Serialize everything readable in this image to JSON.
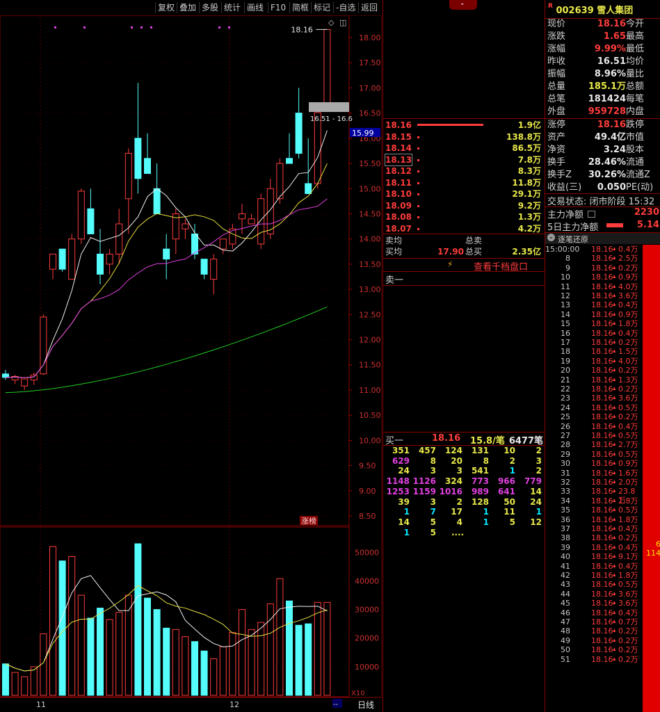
{
  "toolbar": {
    "items": [
      "复权",
      "叠加",
      "多股",
      "统计",
      "画线",
      "F10",
      "简框",
      "标记",
      "-自选",
      "返回"
    ]
  },
  "chart": {
    "price_ticks": [
      "18.00",
      "17.50",
      "17.00",
      "16.50",
      "16.00",
      "15.50",
      "15.00",
      "14.50",
      "14.00",
      "13.50",
      "13.00",
      "12.50",
      "12.00",
      "11.50",
      "11.00",
      "10.50",
      "10.00",
      "9.50",
      "9.00",
      "8.50"
    ],
    "volume_ticks": [
      "50000",
      "40000",
      "30000",
      "20000",
      "10000"
    ],
    "high_label": "18.16",
    "range_label": "16.51 - 16.6",
    "current_price_badge": "15.99",
    "zhangbang_label": "涨榜",
    "x10_label": "X10",
    "period_label": "日线",
    "month_labels": [
      "11",
      "12"
    ],
    "bottom_dash": "--"
  },
  "chart_data": {
    "type": "candlestick",
    "candles": [
      {
        "o": 11.32,
        "h": 11.4,
        "l": 11.2,
        "c": 11.25
      },
      {
        "o": 11.2,
        "h": 11.3,
        "l": 11.12,
        "c": 11.27
      },
      {
        "o": 11.08,
        "h": 11.22,
        "l": 11.0,
        "c": 11.22
      },
      {
        "o": 11.2,
        "h": 11.35,
        "l": 11.1,
        "c": 11.3
      },
      {
        "o": 11.32,
        "h": 12.5,
        "l": 11.3,
        "c": 12.45
      },
      {
        "o": 13.4,
        "h": 13.7,
        "l": 13.2,
        "c": 13.7
      },
      {
        "o": 13.8,
        "h": 13.8,
        "l": 13.35,
        "c": 13.4
      },
      {
        "o": 13.2,
        "h": 14.1,
        "l": 13.2,
        "c": 14.0
      },
      {
        "o": 14.0,
        "h": 15.0,
        "l": 13.9,
        "c": 14.95
      },
      {
        "o": 14.6,
        "h": 15.0,
        "l": 14.1,
        "c": 14.1
      },
      {
        "o": 13.7,
        "h": 14.2,
        "l": 13.1,
        "c": 13.3
      },
      {
        "o": 13.5,
        "h": 13.8,
        "l": 13.3,
        "c": 13.7
      },
      {
        "o": 13.7,
        "h": 14.6,
        "l": 13.5,
        "c": 14.3
      },
      {
        "o": 14.8,
        "h": 15.8,
        "l": 14.1,
        "c": 15.7
      },
      {
        "o": 16.0,
        "h": 17.1,
        "l": 14.9,
        "c": 15.2
      },
      {
        "o": 15.6,
        "h": 16.1,
        "l": 15.3,
        "c": 15.3
      },
      {
        "o": 15.0,
        "h": 15.5,
        "l": 14.5,
        "c": 14.5
      },
      {
        "o": 13.8,
        "h": 14.1,
        "l": 13.2,
        "c": 13.6
      },
      {
        "o": 14.0,
        "h": 14.6,
        "l": 13.7,
        "c": 14.5
      },
      {
        "o": 14.2,
        "h": 14.4,
        "l": 14.0,
        "c": 14.3
      },
      {
        "o": 14.1,
        "h": 14.3,
        "l": 13.6,
        "c": 13.7
      },
      {
        "o": 13.6,
        "h": 13.6,
        "l": 13.2,
        "c": 13.3
      },
      {
        "o": 13.2,
        "h": 13.7,
        "l": 12.9,
        "c": 13.6
      },
      {
        "o": 13.8,
        "h": 14.0,
        "l": 13.7,
        "c": 14.0
      },
      {
        "o": 13.9,
        "h": 14.3,
        "l": 13.8,
        "c": 14.2
      },
      {
        "o": 14.4,
        "h": 14.7,
        "l": 14.1,
        "c": 14.5
      },
      {
        "o": 14.3,
        "h": 14.5,
        "l": 14.3,
        "c": 14.4
      },
      {
        "o": 13.9,
        "h": 14.9,
        "l": 13.8,
        "c": 14.8
      },
      {
        "o": 14.1,
        "h": 15.2,
        "l": 14.0,
        "c": 15.0
      },
      {
        "o": 14.8,
        "h": 15.6,
        "l": 14.7,
        "c": 15.5
      },
      {
        "o": 15.6,
        "h": 16.1,
        "l": 15.5,
        "c": 15.5
      },
      {
        "o": 16.5,
        "h": 17.0,
        "l": 15.6,
        "c": 15.7
      },
      {
        "o": 15.1,
        "h": 16.0,
        "l": 14.9,
        "c": 14.9
      },
      {
        "o": 15.1,
        "h": 16.51,
        "l": 15.0,
        "c": 16.51
      },
      {
        "o": 16.6,
        "h": 18.16,
        "l": 16.6,
        "c": 18.16
      }
    ],
    "volumes": [
      11000,
      8000,
      6500,
      10000,
      21500,
      52000,
      47000,
      48500,
      35000,
      27000,
      30500,
      26500,
      29000,
      35000,
      53000,
      34000,
      30000,
      23500,
      23000,
      20500,
      18800,
      15500,
      12800,
      17000,
      22000,
      30000,
      23000,
      25500,
      32000,
      40800,
      33000,
      24500,
      25000,
      32500,
      32500
    ],
    "ma5_last": 15.9,
    "ma10_last": 15.4,
    "ma20_last": 14.9,
    "ma60_last": 12.65,
    "ylim": [
      8.3,
      18.3
    ],
    "vol_ylim": [
      0,
      53000
    ]
  },
  "quote": {
    "code_prefix": "R",
    "code": "002639",
    "name": "雪人集团",
    "rows": [
      {
        "l": "现价",
        "v": "18.16",
        "c": "red",
        "r": "今开"
      },
      {
        "l": "涨跌",
        "v": "1.65",
        "c": "red",
        "r": "最高"
      },
      {
        "l": "涨幅",
        "v": "9.99%",
        "c": "red",
        "r": "最低"
      },
      {
        "l": "昨收",
        "v": "16.51",
        "c": "white",
        "r": "均价"
      },
      {
        "l": "振幅",
        "v": "8.96%",
        "c": "white",
        "r": "量比"
      },
      {
        "l": "总量",
        "v": "185.1万",
        "c": "yellow",
        "r": "总额"
      },
      {
        "l": "总笔",
        "v": "181424",
        "c": "white",
        "r": "每笔"
      },
      {
        "l": "外盘",
        "v": "959728",
        "c": "red",
        "r": "内盘"
      }
    ],
    "rows2": [
      {
        "l": "涨停",
        "v": "18.16",
        "c": "red",
        "r": "跌停"
      },
      {
        "l": "资产",
        "v": "49.4亿",
        "c": "white",
        "r": "市值"
      },
      {
        "l": "净资",
        "v": "3.24",
        "c": "white",
        "r": "股本"
      },
      {
        "l": "换手",
        "v": "28.46%",
        "c": "white",
        "r": "流通"
      },
      {
        "l": "换手Z",
        "v": "30.26%",
        "c": "white",
        "r": "流通Z"
      },
      {
        "l": "收益(三)",
        "v": "0.050",
        "c": "white",
        "r": "PE(动)"
      }
    ],
    "trade_status": "交易状态: 闭市阶段 15:32",
    "main_net_label": "主力净额",
    "main_net_value": "2230",
    "five_day_label": "5日主力净额",
    "five_day_value": "5.14",
    "tick_header": "逐笔还原",
    "side_numbers": [
      "6",
      "114"
    ]
  },
  "book": {
    "asks": [
      {
        "p": "18.16",
        "q": "1.9亿",
        "w": 95
      },
      {
        "p": "18.15",
        "q": "138.8万",
        "w": 0
      },
      {
        "p": "18.14",
        "q": "86.5万",
        "w": 0
      },
      {
        "p": "18.13",
        "q": "7.8万",
        "w": 0
      },
      {
        "p": "18.12",
        "q": "8.3万",
        "w": 0
      },
      {
        "p": "18.11",
        "q": "11.8万",
        "w": 0
      },
      {
        "p": "18.10",
        "q": "29.1万",
        "w": 0
      },
      {
        "p": "18.09",
        "q": "9.2万",
        "w": 0
      },
      {
        "p": "18.08",
        "q": "1.3万",
        "w": 0
      },
      {
        "p": "18.07",
        "q": "4.2万",
        "w": 0
      }
    ],
    "sell_avg_label": "卖均",
    "total_sell_label": "总卖",
    "buy_avg_label": "买均",
    "buy_avg_value": "17.90",
    "total_buy_label": "总买",
    "total_buy_value": "2.35亿",
    "depth_link": "查看千档盘口",
    "sell1_label": "卖一",
    "buy1_label": "买一",
    "buy1_price": "18.16",
    "buy1_qty": "15.8/笔",
    "buy1_count": "6477笔",
    "grid": [
      [
        {
          "v": "351",
          "c": "yellow"
        },
        {
          "v": "457",
          "c": "yellow"
        },
        {
          "v": "124",
          "c": "yellow"
        },
        {
          "v": "131",
          "c": "yellow"
        },
        {
          "v": "10",
          "c": "yellow"
        },
        {
          "v": "2",
          "c": "yellow"
        }
      ],
      [
        {
          "v": "629",
          "c": "magenta"
        },
        {
          "v": "8",
          "c": "yellow"
        },
        {
          "v": "20",
          "c": "yellow"
        },
        {
          "v": "8",
          "c": "yellow"
        },
        {
          "v": "2",
          "c": "yellow"
        },
        {
          "v": "3",
          "c": "yellow"
        }
      ],
      [
        {
          "v": "24",
          "c": "yellow"
        },
        {
          "v": "3",
          "c": "yellow"
        },
        {
          "v": "3",
          "c": "yellow"
        },
        {
          "v": "541",
          "c": "yellow"
        },
        {
          "v": "1",
          "c": "cyan"
        },
        {
          "v": "2",
          "c": "yellow"
        }
      ],
      [
        {
          "v": "1148",
          "c": "magenta"
        },
        {
          "v": "1126",
          "c": "magenta"
        },
        {
          "v": "324",
          "c": "yellow"
        },
        {
          "v": "773",
          "c": "magenta"
        },
        {
          "v": "966",
          "c": "magenta"
        },
        {
          "v": "779",
          "c": "magenta"
        }
      ],
      [
        {
          "v": "1253",
          "c": "magenta"
        },
        {
          "v": "1159",
          "c": "magenta"
        },
        {
          "v": "1016",
          "c": "magenta"
        },
        {
          "v": "989",
          "c": "magenta"
        },
        {
          "v": "641",
          "c": "magenta"
        },
        {
          "v": "14",
          "c": "yellow"
        }
      ],
      [
        {
          "v": "39",
          "c": "yellow"
        },
        {
          "v": "3",
          "c": "yellow"
        },
        {
          "v": "2",
          "c": "yellow"
        },
        {
          "v": "128",
          "c": "yellow"
        },
        {
          "v": "50",
          "c": "yellow"
        },
        {
          "v": "24",
          "c": "yellow"
        }
      ],
      [
        {
          "v": "1",
          "c": "cyan"
        },
        {
          "v": "7",
          "c": "cyan"
        },
        {
          "v": "17",
          "c": "yellow"
        },
        {
          "v": "1",
          "c": "cyan"
        },
        {
          "v": "11",
          "c": "yellow"
        },
        {
          "v": "1",
          "c": "cyan"
        }
      ],
      [
        {
          "v": "14",
          "c": "yellow"
        },
        {
          "v": "5",
          "c": "yellow"
        },
        {
          "v": "4",
          "c": "yellow"
        },
        {
          "v": "1",
          "c": "cyan"
        },
        {
          "v": "5",
          "c": "yellow"
        },
        {
          "v": "12",
          "c": "yellow"
        }
      ],
      [
        {
          "v": "1",
          "c": "cyan"
        },
        {
          "v": "5",
          "c": "yellow"
        },
        {
          "v": "....",
          "c": "yellow"
        }
      ]
    ]
  },
  "ticks": [
    {
      "t": "15:00:00",
      "p": "18.16",
      "v": "0.4万"
    },
    {
      "t": "8",
      "p": "18.16",
      "v": "2.5万"
    },
    {
      "t": "9",
      "p": "18.16",
      "v": "0.2万"
    },
    {
      "t": "10",
      "p": "18.16",
      "v": "0.9万"
    },
    {
      "t": "11",
      "p": "18.16",
      "v": "4.0万"
    },
    {
      "t": "12",
      "p": "18.16",
      "v": "3.6万"
    },
    {
      "t": "13",
      "p": "18.16",
      "v": "0.4万"
    },
    {
      "t": "14",
      "p": "18.16",
      "v": "0.9万"
    },
    {
      "t": "15",
      "p": "18.16",
      "v": "1.8万"
    },
    {
      "t": "16",
      "p": "18.16",
      "v": "0.4万"
    },
    {
      "t": "17",
      "p": "18.16",
      "v": "0.2万"
    },
    {
      "t": "18",
      "p": "18.16",
      "v": "1.5万"
    },
    {
      "t": "19",
      "p": "18.16",
      "v": "4.0万"
    },
    {
      "t": "20",
      "p": "18.16",
      "v": "0.2万"
    },
    {
      "t": "21",
      "p": "18.16",
      "v": "1.3万"
    },
    {
      "t": "22",
      "p": "18.16",
      "v": "0.2万"
    },
    {
      "t": "23",
      "p": "18.16",
      "v": "3.6万"
    },
    {
      "t": "24",
      "p": "18.16",
      "v": "0.5万"
    },
    {
      "t": "25",
      "p": "18.16",
      "v": "0.2万"
    },
    {
      "t": "26",
      "p": "18.16",
      "v": "0.4万"
    },
    {
      "t": "27",
      "p": "18.16",
      "v": "0.5万"
    },
    {
      "t": "28",
      "p": "18.16",
      "v": "2.7万"
    },
    {
      "t": "29",
      "p": "18.16",
      "v": "0.5万"
    },
    {
      "t": "30",
      "p": "18.16",
      "v": "0.9万"
    },
    {
      "t": "31",
      "p": "18.16",
      "v": "1.6万"
    },
    {
      "t": "32",
      "p": "18.16",
      "v": "2.0万"
    },
    {
      "t": "33",
      "p": "18.16",
      "v": "23.8万"
    },
    {
      "t": "34",
      "p": "18.16",
      "v": "1.8万"
    },
    {
      "t": "35",
      "p": "18.16",
      "v": "0.5万"
    },
    {
      "t": "36",
      "p": "18.16",
      "v": "1.8万"
    },
    {
      "t": "37",
      "p": "18.16",
      "v": "0.4万"
    },
    {
      "t": "38",
      "p": "18.16",
      "v": "0.2万"
    },
    {
      "t": "39",
      "p": "18.16",
      "v": "0.4万"
    },
    {
      "t": "40",
      "p": "18.16",
      "v": "9.1万"
    },
    {
      "t": "41",
      "p": "18.16",
      "v": "0.4万"
    },
    {
      "t": "42",
      "p": "18.16",
      "v": "1.8万"
    },
    {
      "t": "43",
      "p": "18.16",
      "v": "0.5万"
    },
    {
      "t": "44",
      "p": "18.16",
      "v": "3.6万"
    },
    {
      "t": "45",
      "p": "18.16",
      "v": "3.6万"
    },
    {
      "t": "46",
      "p": "18.16",
      "v": "0.4万"
    },
    {
      "t": "47",
      "p": "18.16",
      "v": "0.7万"
    },
    {
      "t": "48",
      "p": "18.16",
      "v": "0.2万"
    },
    {
      "t": "49",
      "p": "18.16",
      "v": "0.2万"
    },
    {
      "t": "50",
      "p": "18.16",
      "v": "0.2万"
    },
    {
      "t": "51",
      "p": "18.16",
      "v": "0.2万"
    }
  ]
}
